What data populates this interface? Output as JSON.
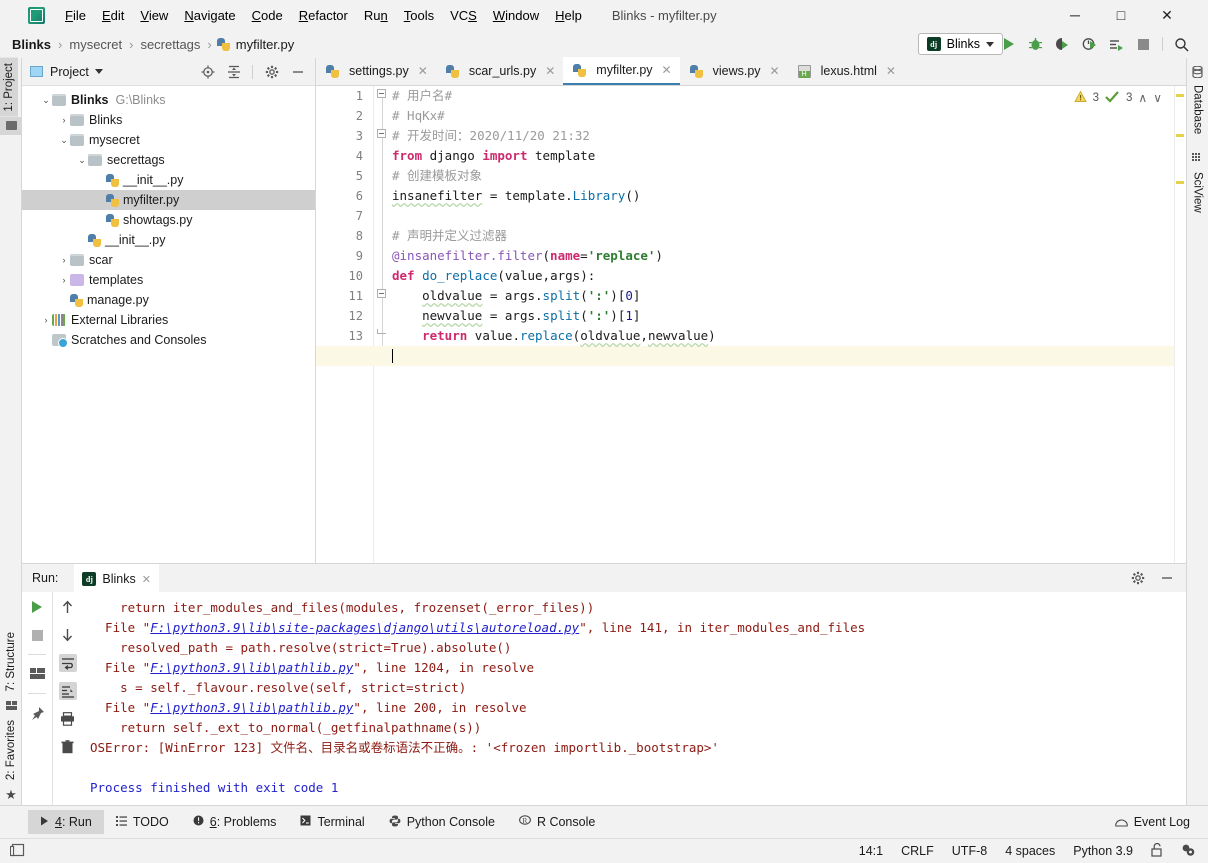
{
  "window": {
    "title": "Blinks - myfilter.py",
    "app_icon": "pycharm-logo-icon",
    "minimize": "─",
    "maximize": "□",
    "close": "✕"
  },
  "menubar": {
    "items": [
      {
        "label": "File"
      },
      {
        "label": "Edit"
      },
      {
        "label": "View"
      },
      {
        "label": "Navigate"
      },
      {
        "label": "Code"
      },
      {
        "label": "Refactor"
      },
      {
        "label": "Run"
      },
      {
        "label": "Tools"
      },
      {
        "label": "VCS"
      },
      {
        "label": "Window"
      },
      {
        "label": "Help"
      }
    ]
  },
  "breadcrumb": {
    "items": [
      "Blinks",
      "mysecret",
      "secrettags",
      "myfilter.py"
    ],
    "separator": "›"
  },
  "run_config": {
    "badge": "dj",
    "name": "Blinks",
    "dropdown_caret": "▾",
    "toolbar_icons": [
      "run-icon",
      "debug-icon",
      "run-coverage-icon",
      "profile-icon",
      "run-with-params-icon",
      "stop-icon",
      "search-everywhere-icon"
    ]
  },
  "left_strip": {
    "top_tabs": [
      {
        "label": "1: Project",
        "active": true
      }
    ],
    "bottom_tabs": [
      {
        "label": "7: Structure",
        "active": false
      },
      {
        "label": "2: Favorites",
        "active": false
      }
    ]
  },
  "right_strip": {
    "tabs": [
      {
        "label": "Database"
      },
      {
        "label": "SciView"
      }
    ]
  },
  "project_panel": {
    "title": "Project",
    "dropdown_caret": "▾",
    "tools": [
      "locate-icon",
      "collapse-all-icon",
      "settings-gear-icon",
      "hide-icon"
    ],
    "tree": [
      {
        "depth": 0,
        "arrow": "⌄",
        "icon": "folder-grey",
        "label": "Blinks",
        "bold": true,
        "path": "G:\\Blinks",
        "selected": false
      },
      {
        "depth": 1,
        "arrow": "›",
        "icon": "folder-grey",
        "label": "Blinks",
        "bold": false,
        "path": "",
        "selected": false
      },
      {
        "depth": 1,
        "arrow": "⌄",
        "icon": "folder-grey",
        "label": "mysecret",
        "bold": false,
        "path": "",
        "selected": false
      },
      {
        "depth": 2,
        "arrow": "⌄",
        "icon": "folder-grey",
        "label": "secrettags",
        "bold": false,
        "path": "",
        "selected": false
      },
      {
        "depth": 3,
        "arrow": "",
        "icon": "python-file",
        "label": "__init__.py",
        "bold": false,
        "path": "",
        "selected": false
      },
      {
        "depth": 3,
        "arrow": "",
        "icon": "python-file",
        "label": "myfilter.py",
        "bold": false,
        "path": "",
        "selected": true
      },
      {
        "depth": 3,
        "arrow": "",
        "icon": "python-file",
        "label": "showtags.py",
        "bold": false,
        "path": "",
        "selected": false
      },
      {
        "depth": 2,
        "arrow": "",
        "icon": "python-file",
        "label": "__init__.py",
        "bold": false,
        "path": "",
        "selected": false
      },
      {
        "depth": 1,
        "arrow": "›",
        "icon": "folder-grey",
        "label": "scar",
        "bold": false,
        "path": "",
        "selected": false
      },
      {
        "depth": 1,
        "arrow": "›",
        "icon": "folder-purple",
        "label": "templates",
        "bold": false,
        "path": "",
        "selected": false
      },
      {
        "depth": 1,
        "arrow": "",
        "icon": "python-file",
        "label": "manage.py",
        "bold": false,
        "path": "",
        "selected": false
      },
      {
        "depth": 0,
        "arrow": "›",
        "icon": "libraries",
        "label": "External Libraries",
        "bold": false,
        "path": "",
        "selected": false
      },
      {
        "depth": 0,
        "arrow": "",
        "icon": "scratches",
        "label": "Scratches and Consoles",
        "bold": false,
        "path": "",
        "selected": false
      }
    ]
  },
  "editor": {
    "tabs": [
      {
        "label": "settings.py",
        "icon": "python-file",
        "active": false
      },
      {
        "label": "scar_urls.py",
        "icon": "python-file",
        "active": false
      },
      {
        "label": "myfilter.py",
        "icon": "python-file",
        "active": true
      },
      {
        "label": "views.py",
        "icon": "python-file",
        "active": false
      },
      {
        "label": "lexus.html",
        "icon": "html-file",
        "active": false
      }
    ],
    "tab_close": "✕",
    "inspections": {
      "warning_icon": "warning-triangle-icon",
      "warning_count": "3",
      "ok_icon": "inspection-ok-icon",
      "ok_count": "3",
      "prev_icon": "∧",
      "next_icon": "∨"
    },
    "line_numbers": [
      "1",
      "2",
      "3",
      "4",
      "5",
      "6",
      "7",
      "8",
      "9",
      "10",
      "11",
      "12",
      "13",
      "14"
    ],
    "current_line": 14,
    "code": [
      {
        "n": 1,
        "text": "# 用户名#"
      },
      {
        "n": 2,
        "text": "# HqKx#"
      },
      {
        "n": 3,
        "text": "# 开发时间：2020/11/20 21:32"
      },
      {
        "n": 4,
        "text": "from django import template"
      },
      {
        "n": 5,
        "text": "# 创建模板对象"
      },
      {
        "n": 6,
        "text": "insanefilter = template.Library()"
      },
      {
        "n": 7,
        "text": ""
      },
      {
        "n": 8,
        "text": "# 声明并定义过滤器"
      },
      {
        "n": 9,
        "text": "@insanefilter.filter(name='replace')"
      },
      {
        "n": 10,
        "text": "def do_replace(value,args):"
      },
      {
        "n": 11,
        "text": "    oldvalue = args.split(':')[0]"
      },
      {
        "n": 12,
        "text": "    newvalue = args.split(':')[1]"
      },
      {
        "n": 13,
        "text": "    return value.replace(oldvalue,newvalue)"
      },
      {
        "n": 14,
        "text": ""
      }
    ]
  },
  "run_panel": {
    "label": "Run:",
    "tab": {
      "badge": "dj",
      "label": "Blinks",
      "close": "✕"
    },
    "header_tools": [
      "settings-gear-icon",
      "hide-icon"
    ],
    "tools_left": [
      "rerun-icon",
      "stop-icon",
      "layout-icon",
      "pin-icon"
    ],
    "tools_right": [
      "up-arrow-icon",
      "down-arrow-icon",
      "soft-wrap-icon",
      "scroll-to-end-icon",
      "print-icon",
      "trash-icon"
    ],
    "console": [
      {
        "segments": [
          {
            "t": "    return iter_modules_and_files(modules, frozenset(_error_files))",
            "k": "err"
          }
        ]
      },
      {
        "segments": [
          {
            "t": "  File \"",
            "k": "err"
          },
          {
            "t": "F:\\python3.9\\lib\\site-packages\\django\\utils\\autoreload.py",
            "k": "link"
          },
          {
            "t": "\", line 141, in iter_modules_and_files",
            "k": "err"
          }
        ]
      },
      {
        "segments": [
          {
            "t": "    resolved_path = path.resolve(strict=True).absolute()",
            "k": "err"
          }
        ]
      },
      {
        "segments": [
          {
            "t": "  File \"",
            "k": "err"
          },
          {
            "t": "F:\\python3.9\\lib\\pathlib.py",
            "k": "link"
          },
          {
            "t": "\", line 1204, in resolve",
            "k": "err"
          }
        ]
      },
      {
        "segments": [
          {
            "t": "    s = self._flavour.resolve(self, strict=strict)",
            "k": "err"
          }
        ]
      },
      {
        "segments": [
          {
            "t": "  File \"",
            "k": "err"
          },
          {
            "t": "F:\\python3.9\\lib\\pathlib.py",
            "k": "link"
          },
          {
            "t": "\", line 200, in resolve",
            "k": "err"
          }
        ]
      },
      {
        "segments": [
          {
            "t": "    return self._ext_to_normal(_getfinalpathname(s))",
            "k": "err"
          }
        ]
      },
      {
        "segments": [
          {
            "t": "OSError: [WinError 123] 文件名、目录名或卷标语法不正确。: '<frozen importlib._bootstrap>'",
            "k": "err"
          }
        ]
      },
      {
        "segments": [
          {
            "t": "",
            "k": "err"
          }
        ]
      },
      {
        "segments": [
          {
            "t": "Process finished with exit code 1",
            "k": "blue"
          }
        ]
      }
    ]
  },
  "bottom_bar": {
    "tabs": [
      {
        "label": "4: Run",
        "icon": "run-triangle-icon",
        "active": true
      },
      {
        "label": "TODO",
        "icon": "todo-icon",
        "active": false
      },
      {
        "label": "6: Problems",
        "icon": "problems-icon",
        "active": false
      },
      {
        "label": "Terminal",
        "icon": "terminal-icon",
        "active": false
      },
      {
        "label": "Python Console",
        "icon": "python-console-icon",
        "active": false
      },
      {
        "label": "R Console",
        "icon": "r-console-icon",
        "active": false
      }
    ],
    "event_log": {
      "label": "Event Log",
      "icon": "event-log-icon"
    }
  },
  "status_bar": {
    "left_icon": "toggle-toolwindows-icon",
    "caret_position": "14:1",
    "line_separator": "CRLF",
    "encoding": "UTF-8",
    "indent": "4 spaces",
    "interpreter": "Python 3.9",
    "lock_icon": "unlocked-icon",
    "inspection_icon": "inspection-level-icon"
  },
  "colors": {
    "accent_blue": "#3c7fb1",
    "keyword_pink": "#cc2a6d",
    "string_green": "#2e7d32",
    "comment_grey": "#9a9a9a",
    "error_red": "#8b1a12",
    "link_blue": "#2222cc",
    "selection_grey": "#cfcfcf",
    "current_line_yellow": "#fbf8e5",
    "run_green": "#4a9e4a"
  }
}
